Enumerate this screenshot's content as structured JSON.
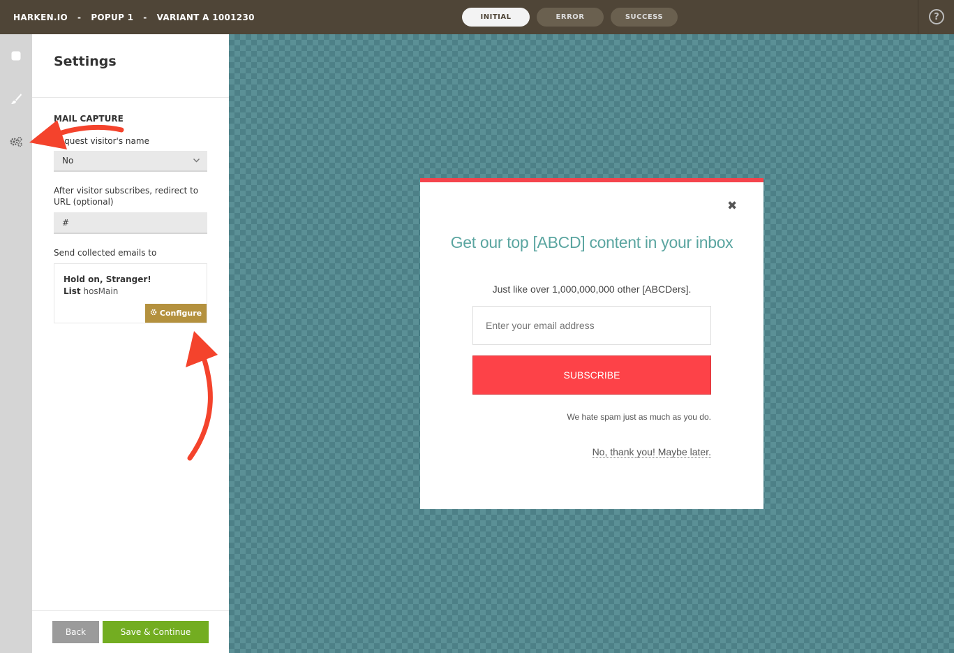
{
  "header": {
    "brand": "HARKEN.IO",
    "separator": "-",
    "popup_name": "POPUP 1",
    "variant": "VARIANT A 1001230",
    "state_tabs": [
      {
        "label": "INITIAL",
        "active": true
      },
      {
        "label": "ERROR",
        "active": false
      },
      {
        "label": "SUCCESS",
        "active": false
      }
    ],
    "help_label": "?"
  },
  "rail": {
    "icons": [
      "square-icon",
      "brush-icon",
      "gears-icon"
    ]
  },
  "settings": {
    "title": "Settings",
    "section": "MAIL CAPTURE",
    "request_name_label": "Request visitor's name",
    "request_name_value": "No",
    "redirect_label": "After visitor subscribes, redirect to URL (optional)",
    "redirect_value": "#",
    "send_to_label": "Send collected emails to",
    "list_card": {
      "name": "Hold on, Stranger!",
      "list_prefix": "List",
      "list_value": "hosMain",
      "configure_label": "Configure"
    },
    "back_label": "Back",
    "save_label": "Save & Continue"
  },
  "popup": {
    "close_glyph": "✖",
    "headline": "Get our top [ABCD] content in your inbox",
    "subheadline": "Just like over 1,000,000,000 other [ABCDers].",
    "email_placeholder": "Enter your email address",
    "subscribe_label": "SUBSCRIBE",
    "spam_note": "We hate spam just as much as you do.",
    "decline_label": "No, thank you! Maybe later.",
    "accent_color": "#f4434c",
    "headline_color": "#5aa5a0"
  },
  "colors": {
    "topbar": "#4f4537",
    "rail": "#d5d5d5",
    "configure": "#b4913e",
    "save": "#73ad21",
    "back": "#9b9b9b",
    "annotation_arrow": "#f4432c"
  }
}
